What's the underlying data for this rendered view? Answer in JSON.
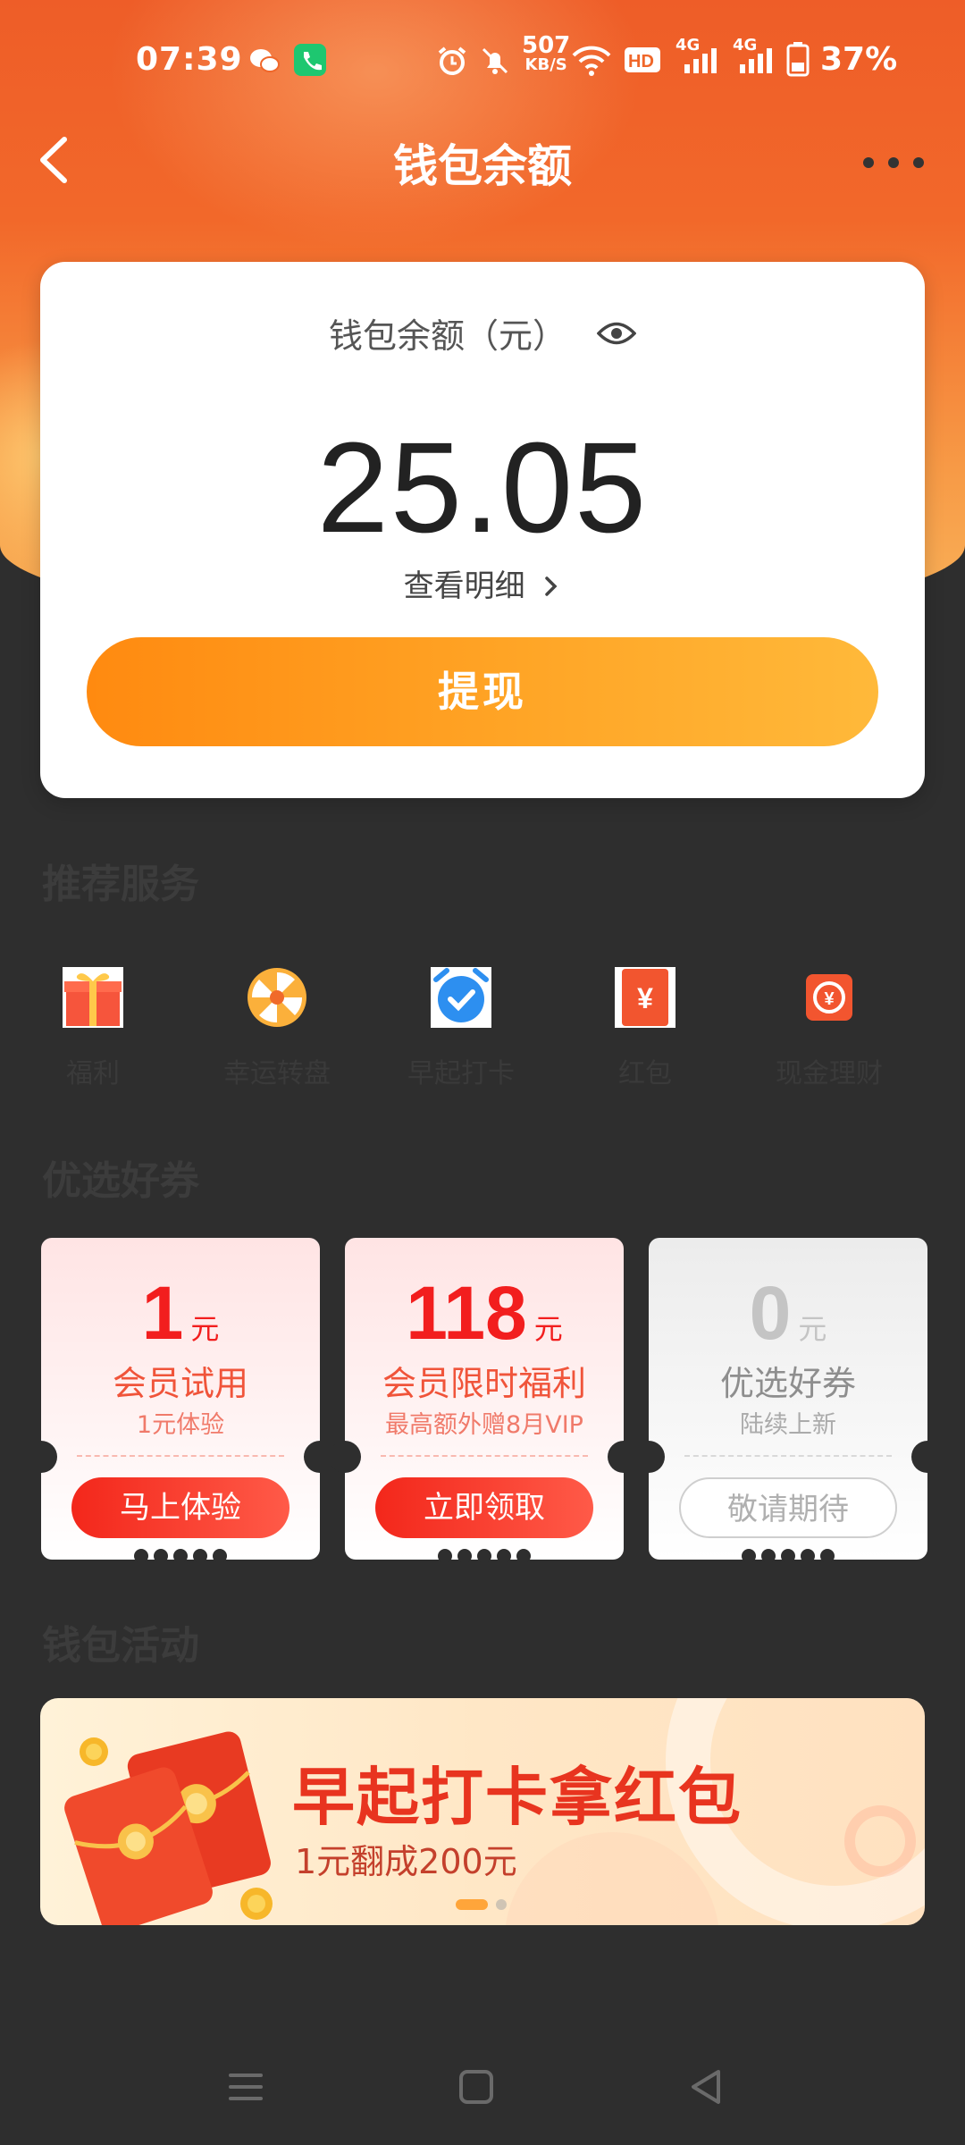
{
  "status_bar": {
    "time": "07:39",
    "net_speed_value": "507",
    "net_speed_unit": "KB/S",
    "network_1": "4G",
    "network_2": "4G",
    "hd_label": "HD",
    "battery": "37%",
    "icons": [
      "wechat-icon",
      "phone-app-icon",
      "alarm-icon",
      "mute-icon",
      "wifi-icon",
      "hd-call-icon",
      "signal-icon",
      "battery-icon"
    ]
  },
  "nav": {
    "title": "钱包余额"
  },
  "balance_card": {
    "label": "钱包余额（元）",
    "amount": "25.05",
    "detail_link": "查看明细",
    "withdraw_button": "提现"
  },
  "services": {
    "title": "推荐服务",
    "items": [
      {
        "label": "福利",
        "icon": "gift-icon"
      },
      {
        "label": "幸运转盘",
        "icon": "lucky-wheel-icon"
      },
      {
        "label": "早起打卡",
        "icon": "alarm-clock-icon"
      },
      {
        "label": "红包",
        "icon": "red-packet-icon"
      },
      {
        "label": "现金理财",
        "icon": "cash-cycle-icon"
      }
    ]
  },
  "coupons": {
    "title": "优选好券",
    "items": [
      {
        "value": "1",
        "unit": "元",
        "name": "会员试用",
        "sub": "1元体验",
        "button": "马上体验",
        "style": "red"
      },
      {
        "value": "118",
        "unit": "元",
        "name": "会员限时福利",
        "sub": "最高额外赠8月VIP",
        "button": "立即领取",
        "style": "red"
      },
      {
        "value": "0",
        "unit": "元",
        "name": "优选好券",
        "sub": "陆续上新",
        "button": "敬请期待",
        "style": "gray"
      }
    ]
  },
  "activities": {
    "title": "钱包活动",
    "banner": {
      "headline": "早起打卡拿红包",
      "subline": "1元翻成200元",
      "pages": 2,
      "active_page": 1
    }
  },
  "colors": {
    "header_orange": "#ee5d28",
    "button_orange": "#ff9a1f",
    "coupon_red": "#f21e1e",
    "background_dark": "#2e2e2e"
  }
}
